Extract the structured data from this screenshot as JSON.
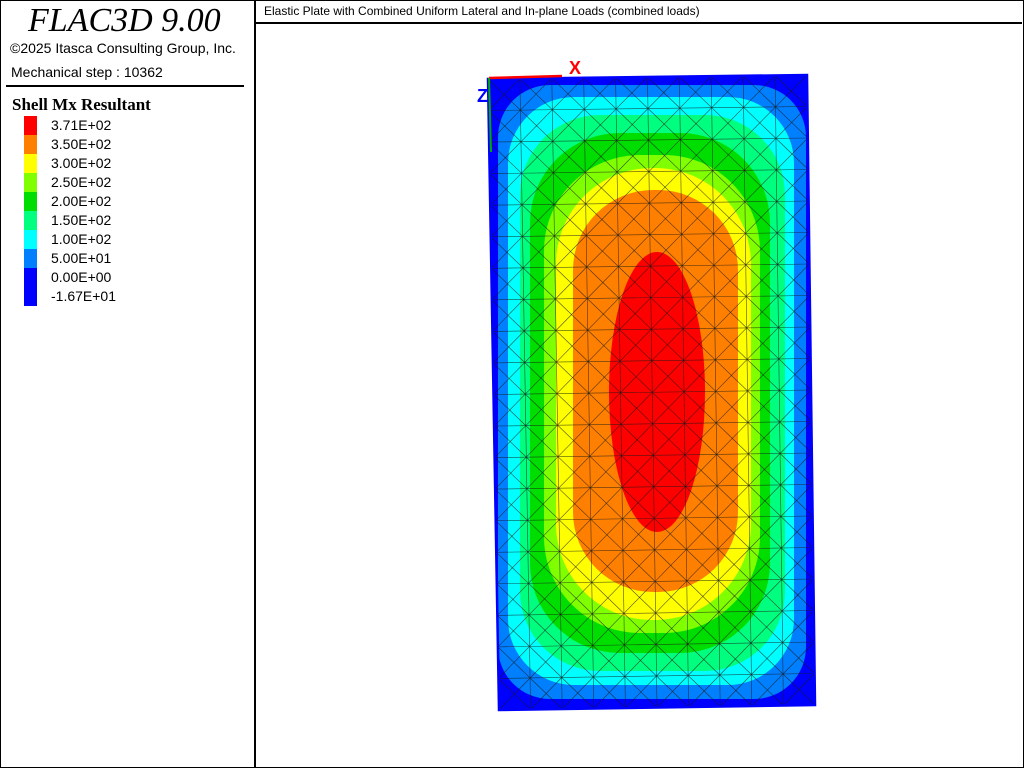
{
  "app": {
    "name": "FLAC3D 9.00",
    "copyright": "©2025 Itasca Consulting Group, Inc.",
    "step_label": "Mechanical step : 10362"
  },
  "plot": {
    "title": "Elastic Plate with Combined Uniform Lateral and In-plane Loads (combined loads)"
  },
  "legend": {
    "title": "Shell Mx Resultant",
    "items": [
      {
        "label": "3.71E+02",
        "color": "#ff0000"
      },
      {
        "label": "3.50E+02",
        "color": "#ff7f00"
      },
      {
        "label": "3.00E+02",
        "color": "#ffff00"
      },
      {
        "label": "2.50E+02",
        "color": "#7fff00"
      },
      {
        "label": "2.00E+02",
        "color": "#00dd00"
      },
      {
        "label": "1.50E+02",
        "color": "#00ff7f"
      },
      {
        "label": "1.00E+02",
        "color": "#00ffff"
      },
      {
        "label": "5.00E+01",
        "color": "#007fff"
      },
      {
        "label": "0.00E+00",
        "color": "#0000ff"
      },
      {
        "label": "-1.67E+01",
        "color": "#0000ff"
      }
    ]
  },
  "axes": {
    "x_label": "X",
    "z_label": "Z",
    "x_color": "#ff0000",
    "z_color": "#0000ff",
    "y_color": "#00aa00"
  }
}
